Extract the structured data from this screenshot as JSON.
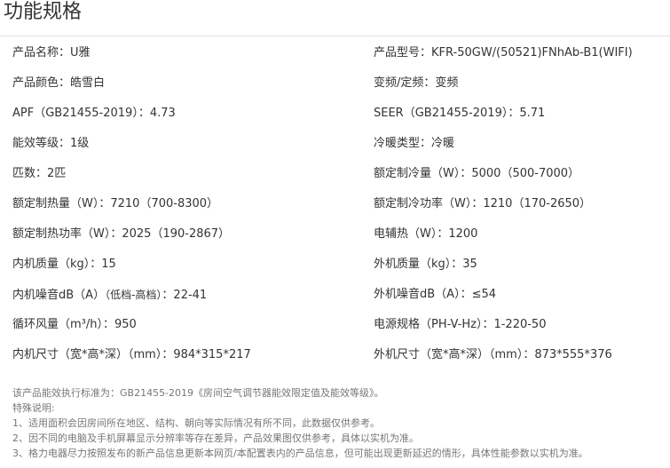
{
  "title": "功能规格",
  "specs": [
    {
      "left": "产品名称：U雅",
      "right": "产品型号：KFR-50GW/(50521)FNhAb-B1(WIFI)"
    },
    {
      "left": "产品颜色：皓雪白",
      "right": "变频/定频：变频"
    },
    {
      "left": "APF（GB21455-2019）：4.73",
      "right": "SEER（GB21455-2019）：5.71"
    },
    {
      "left": "能效等级：1级",
      "right": "冷暖类型：冷暖"
    },
    {
      "left": "匹数：2匹",
      "right": "额定制冷量（W）：5000（500-7000）"
    },
    {
      "left": "额定制热量（W）：7210（700-8300）",
      "right": "额定制冷功率（W）：1210（170-2650）"
    },
    {
      "left": "额定制热功率（W）：2025（190-2867）",
      "right": "电辅热（W）：1200"
    },
    {
      "left": "内机质量（kg）：15",
      "right": "外机质量（kg）：35"
    },
    {
      "left_a": "内机噪音dB（A）",
      "left_b": "（低档-高档）",
      "left_c": "：22-41",
      "right": "外机噪音dB（A）：≤54"
    },
    {
      "left": "循环风量（m³/h）：950",
      "right": "电源规格（PH-V-Hz）：1-220-50"
    },
    {
      "left": "内机尺寸（宽*高*深）（mm）：984*315*217",
      "right": "外机尺寸（宽*高*深）（mm）：873*555*376"
    }
  ],
  "notes": [
    "该产品能效执行标准为：GB21455-2019《房间空气调节器能效限定值及能效等级》。",
    "特殊说明:",
    "1、适用面积会因房间所在地区、结构、朝向等实际情况有所不同，此数据仅供参考。",
    "2、因不同的电脑及手机屏幕显示分辨率等存在差异，产品效果图仅供参考，具体以实机为准。",
    "3、格力电器尽力按照发布的新产品信息更新本网页/本配置表内的产品信息，但可能出现更新延迟的情形，具体性能参数以实机为准。"
  ]
}
